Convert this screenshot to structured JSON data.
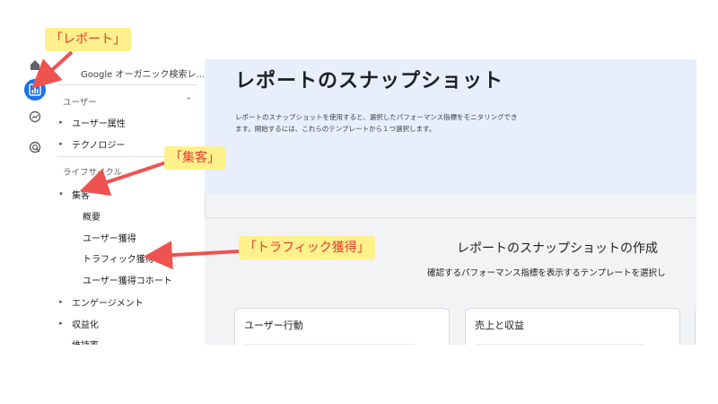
{
  "sidebar": {
    "property_name": "Google オーガニック検索レ...",
    "sections": {
      "user": {
        "label": "ユーザー",
        "items": [
          "ユーザー属性",
          "テクノロジー"
        ]
      },
      "lifecycle": {
        "label": "ライフサイクル",
        "acquisition": {
          "label": "集客",
          "children": [
            "概要",
            "ユーザー獲得",
            "トラフィック獲得",
            "ユーザー獲得コホート"
          ]
        },
        "items": [
          "エンゲージメント",
          "収益化",
          "維持率"
        ]
      }
    }
  },
  "hero": {
    "title": "レポートのスナップショット",
    "description": "レポートのスナップショットを使用すると、選択したパフォーマンス指標をモニタリングできます。開始するには、これらのテンプレートから１つ選択します。"
  },
  "create": {
    "title": "レポートのスナップショットの作成",
    "subtitle": "確認するパフォーマンス指標を表示するテンプレートを選択し"
  },
  "cards": [
    {
      "title": "ユーザー行動"
    },
    {
      "title": "売上と収益"
    }
  ],
  "annotations": {
    "report": "「レポート」",
    "acquisition": "「集客」",
    "traffic": "「トラフィック獲得」"
  },
  "colors": {
    "accent": "#1a73e8",
    "annotation_text": "#e53935",
    "annotation_bg": "#fef08a",
    "arrow": "#ef5350",
    "hero_bg": "#e8eefc"
  },
  "icons": {
    "rail": [
      "home-icon",
      "reports-icon",
      "explore-icon",
      "advertising-icon"
    ]
  }
}
